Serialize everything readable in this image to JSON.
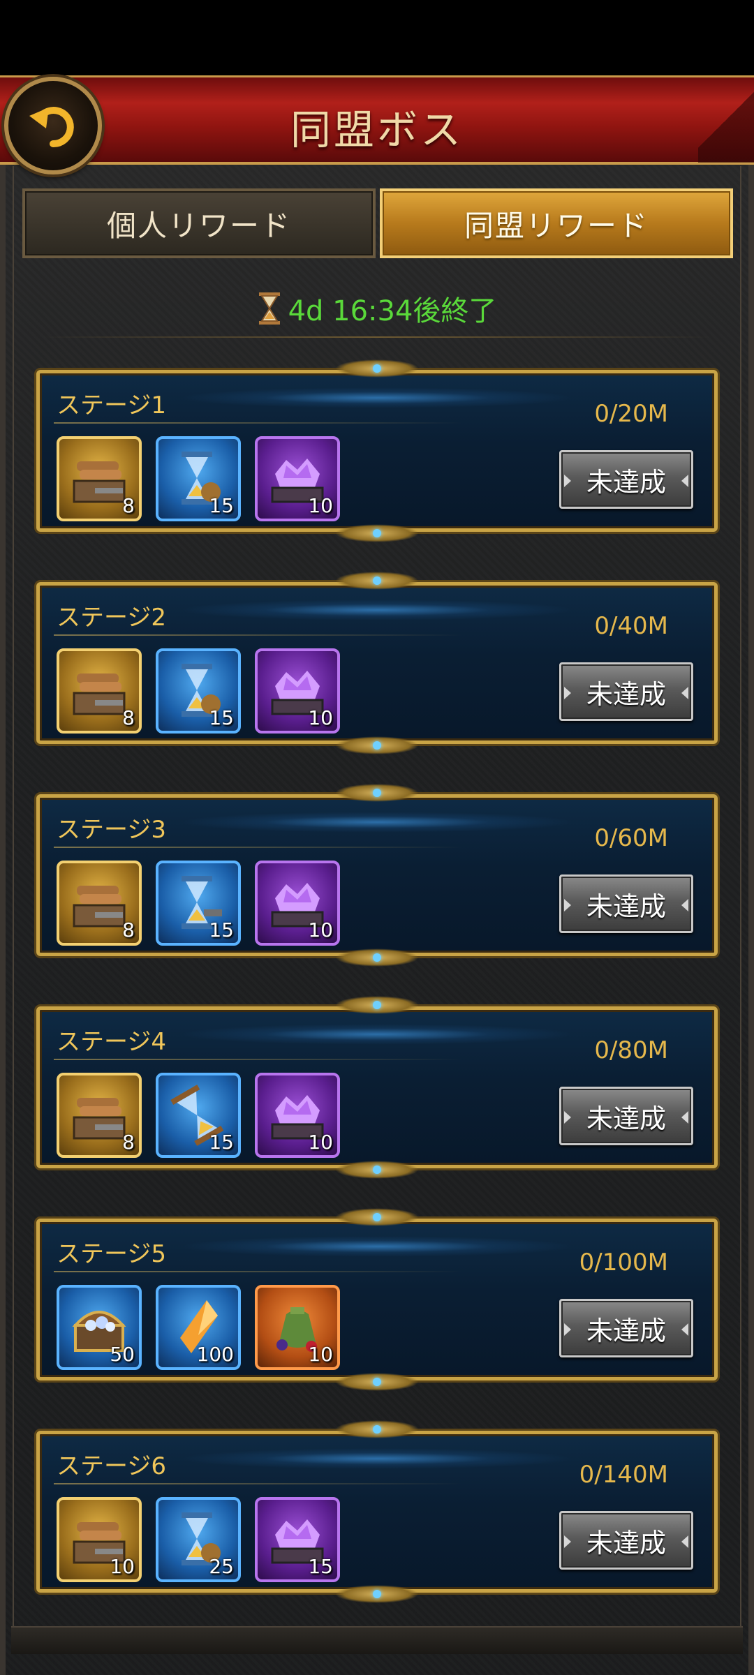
{
  "header": {
    "title": "同盟ボス"
  },
  "tabs": {
    "personal": "個人リワード",
    "alliance": "同盟リワード"
  },
  "timer": {
    "text": "4d 16:34後終了"
  },
  "stages": [
    {
      "title": "ステージ1",
      "progress": "0/20M",
      "status": "未達成",
      "items": [
        {
          "icon": "wood-crate-icon",
          "frame": "gold",
          "qty": "8"
        },
        {
          "icon": "hourglass-speedup-icon",
          "frame": "blue",
          "qty": "15"
        },
        {
          "icon": "gem-cart-icon",
          "frame": "purple",
          "qty": "10"
        }
      ]
    },
    {
      "title": "ステージ2",
      "progress": "0/40M",
      "status": "未達成",
      "items": [
        {
          "icon": "wood-crate-icon",
          "frame": "gold",
          "qty": "8"
        },
        {
          "icon": "hourglass-speedup-icon",
          "frame": "blue",
          "qty": "15"
        },
        {
          "icon": "gem-cart-icon",
          "frame": "purple",
          "qty": "10"
        }
      ]
    },
    {
      "title": "ステージ3",
      "progress": "0/60M",
      "status": "未達成",
      "items": [
        {
          "icon": "wood-crate-icon",
          "frame": "gold",
          "qty": "8"
        },
        {
          "icon": "hourglass-speedup-icon",
          "frame": "blue",
          "qty": "15"
        },
        {
          "icon": "gem-cart-icon",
          "frame": "purple",
          "qty": "10"
        }
      ]
    },
    {
      "title": "ステージ4",
      "progress": "0/80M",
      "status": "未達成",
      "items": [
        {
          "icon": "wood-crate-icon",
          "frame": "gold",
          "qty": "8"
        },
        {
          "icon": "hourglass-speedup-icon",
          "frame": "blue",
          "qty": "15"
        },
        {
          "icon": "gem-cart-icon",
          "frame": "purple",
          "qty": "10"
        }
      ]
    },
    {
      "title": "ステージ5",
      "progress": "0/100M",
      "status": "未達成",
      "items": [
        {
          "icon": "treasure-chest-icon",
          "frame": "blue",
          "qty": "50"
        },
        {
          "icon": "crystal-shard-icon",
          "frame": "blue",
          "qty": "100"
        },
        {
          "icon": "loot-bag-icon",
          "frame": "orange",
          "qty": "10"
        }
      ]
    },
    {
      "title": "ステージ6",
      "progress": "0/140M",
      "status": "未達成",
      "items": [
        {
          "icon": "wood-crate-icon",
          "frame": "gold",
          "qty": "10"
        },
        {
          "icon": "hourglass-speedup-icon",
          "frame": "blue",
          "qty": "25"
        },
        {
          "icon": "gem-cart-icon",
          "frame": "purple",
          "qty": "15"
        }
      ]
    }
  ],
  "colors": {
    "accent_gold": "#c9a446",
    "timer_green": "#5ad93a",
    "header_red": "#b1201a"
  }
}
